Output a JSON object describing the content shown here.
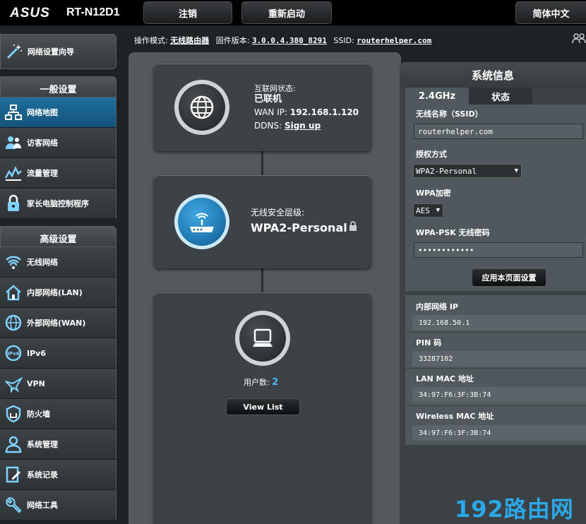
{
  "header": {
    "brand": "ASUS",
    "model": "RT-N12D1",
    "logout_label": "注销",
    "reboot_label": "重新启动",
    "language_label": "简体中文"
  },
  "infobar": {
    "mode_label": "操作模式:",
    "mode_value": "无线路由器",
    "firmware_label": "固件版本:",
    "firmware_value": "3.0.0.4.380_8291",
    "ssid_label": "SSID:",
    "ssid_value": "routerhelper.com"
  },
  "sidebar": {
    "wizard_label": "网络设置向导",
    "general_title": "一般设置",
    "general_items": [
      {
        "label": "网络地图",
        "icon": "network-map-icon",
        "active": true
      },
      {
        "label": "访客网络",
        "icon": "guest-network-icon",
        "active": false
      },
      {
        "label": "流量管理",
        "icon": "traffic-manager-icon",
        "active": false
      },
      {
        "label": "家长电脑控制程序",
        "icon": "parental-control-icon",
        "active": false
      }
    ],
    "advanced_title": "高级设置",
    "advanced_items": [
      {
        "label": "无线网络",
        "icon": "wireless-icon"
      },
      {
        "label": "内部网络(LAN)",
        "icon": "home-lan-icon"
      },
      {
        "label": "外部网络(WAN)",
        "icon": "globe-wan-icon"
      },
      {
        "label": "IPv6",
        "icon": "ipv6-icon"
      },
      {
        "label": "VPN",
        "icon": "vpn-icon"
      },
      {
        "label": "防火墙",
        "icon": "firewall-icon"
      },
      {
        "label": "系统管理",
        "icon": "admin-icon"
      },
      {
        "label": "系统记录",
        "icon": "system-log-icon"
      },
      {
        "label": "网络工具",
        "icon": "network-tools-icon"
      }
    ]
  },
  "map": {
    "internet": {
      "status_label": "互联网状态:",
      "status_value": "已联机",
      "wan_ip_label": "WAN IP:",
      "wan_ip_value": "192.168.1.120",
      "ddns_label": "DDNS:",
      "ddns_link": "Sign up"
    },
    "wireless": {
      "security_label": "无线安全层级:",
      "security_value": "WPA2-Personal"
    },
    "clients": {
      "count_label": "用户数:",
      "count_value": "2",
      "view_list_label": "View List"
    }
  },
  "system_info": {
    "title": "系统信息",
    "tab_band": "2.4GHz",
    "tab_status": "状态",
    "ssid_label": "无线名称（SSID）",
    "ssid_value": "routerhelper.com",
    "auth_label": "授权方式",
    "auth_value": "WPA2-Personal",
    "encryption_label": "WPA加密",
    "encryption_value": "AES",
    "psk_label": "WPA-PSK 无线密码",
    "psk_value": "••••••••••••",
    "apply_label": "应用本页面设置",
    "lan_ip_label": "内部网络 IP",
    "lan_ip_value": "192.168.50.1",
    "pin_label": "PIN 码",
    "pin_value": "33287102",
    "lan_mac_label": "LAN MAC 地址",
    "lan_mac_value": "34:97:F6:3F:3B:74",
    "wireless_mac_label": "Wireless MAC 地址",
    "wireless_mac_value": "34:97:F6:3F:3B:74"
  },
  "watermark": "192路由网",
  "colors": {
    "accent_blue": "#1f6f9e",
    "client_count": "#4fb8ff",
    "watermark": "#2aa8e8"
  }
}
